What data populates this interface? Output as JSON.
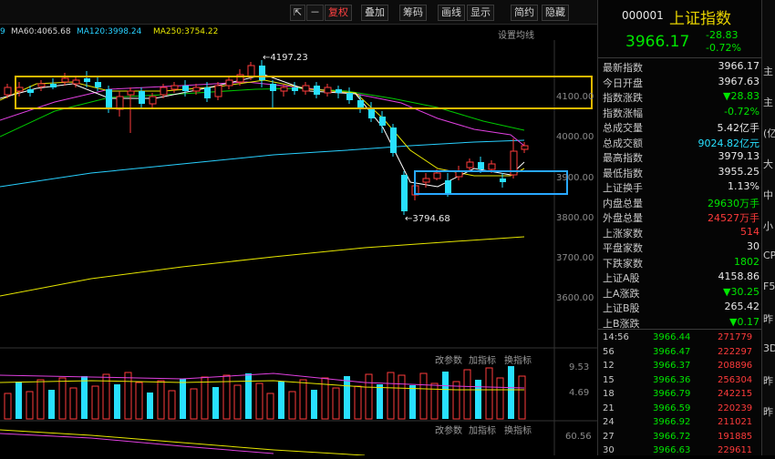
{
  "top_menu": [
    "…",
    "…",
    "…",
    "…",
    "…",
    "…",
    "…"
  ],
  "toolbar": {
    "period": "复权",
    "overlay": "叠加",
    "chips": "筹码",
    "draw": "画线",
    "display": "显示",
    "simple": "简约",
    "hide": "隐藏"
  },
  "ma": [
    {
      "label": "MA60:4065.68",
      "color": "#d6d6d6"
    },
    {
      "label": "MA120:3998.24",
      "color": "#28d0ff"
    },
    {
      "label": "MA250:3754.22",
      "color": "#e6e600"
    }
  ],
  "settings_label": "设置均线",
  "price_axis": [
    "4100.00",
    "4000.00",
    "3900.00",
    "3800.00",
    "3700.00",
    "3600.00"
  ],
  "annotations": {
    "high": "4197.23",
    "low": "3794.68"
  },
  "volume": {
    "label_params": "改参数",
    "label_add": "加指标",
    "label_switch": "换指标",
    "axis": [
      "9.53",
      "4.69"
    ]
  },
  "macd": {
    "axis": "60.56"
  },
  "quote": {
    "code": "000001",
    "name": "上证指数",
    "price": "3966.17",
    "change": "-28.83",
    "pct": "-0.72%",
    "rows": [
      {
        "k": "最新指数",
        "v": "3966.17",
        "c": "white"
      },
      {
        "k": "今日开盘",
        "v": "3967.63",
        "c": "white"
      },
      {
        "k": "指数涨跌",
        "v": "▼28.83",
        "c": "green"
      },
      {
        "k": "指数涨幅",
        "v": "-0.72%",
        "c": "green"
      },
      {
        "k": "总成交量",
        "v": "5.42亿手",
        "c": "white"
      },
      {
        "k": "总成交额",
        "v": "9024.82亿元",
        "c": "cyan"
      },
      {
        "k": "最高指数",
        "v": "3979.13",
        "c": "white"
      },
      {
        "k": "最低指数",
        "v": "3955.25",
        "c": "white"
      },
      {
        "k": "上证换手",
        "v": "1.13%",
        "c": "white"
      },
      {
        "k": "内盘总量",
        "v": "29630万手",
        "c": "green"
      },
      {
        "k": "外盘总量",
        "v": "24527万手",
        "c": "red"
      },
      {
        "k": "上涨家数",
        "v": "514",
        "c": "red"
      },
      {
        "k": "平盘家数",
        "v": "30",
        "c": "white"
      },
      {
        "k": "下跌家数",
        "v": "1802",
        "c": "green"
      },
      {
        "k": "上证A股",
        "v": "4158.86",
        "c": "white"
      },
      {
        "k": "上A涨跌",
        "v": "▼30.25",
        "c": "green"
      },
      {
        "k": "上证B股",
        "v": "265.42",
        "c": "white"
      },
      {
        "k": "上B涨跌",
        "v": "▼0.17",
        "c": "green"
      }
    ],
    "ticks": [
      {
        "t": "14:56",
        "p": "3966.44",
        "v": "271779"
      },
      {
        "t": "56",
        "p": "3966.47",
        "v": "222297"
      },
      {
        "t": "12",
        "p": "3966.37",
        "v": "208896"
      },
      {
        "t": "15",
        "p": "3966.36",
        "v": "256304"
      },
      {
        "t": "18",
        "p": "3966.79",
        "v": "242215"
      },
      {
        "t": "21",
        "p": "3966.59",
        "v": "220239"
      },
      {
        "t": "24",
        "p": "3966.92",
        "v": "211021"
      },
      {
        "t": "27",
        "p": "3966.72",
        "v": "191885"
      },
      {
        "t": "30",
        "p": "3966.63",
        "v": "229611"
      }
    ]
  },
  "edge": [
    "主",
    "主",
    "(亿",
    "大",
    "中",
    "小",
    "CP",
    "F5",
    "昨",
    "3D",
    "昨",
    "昨"
  ]
}
